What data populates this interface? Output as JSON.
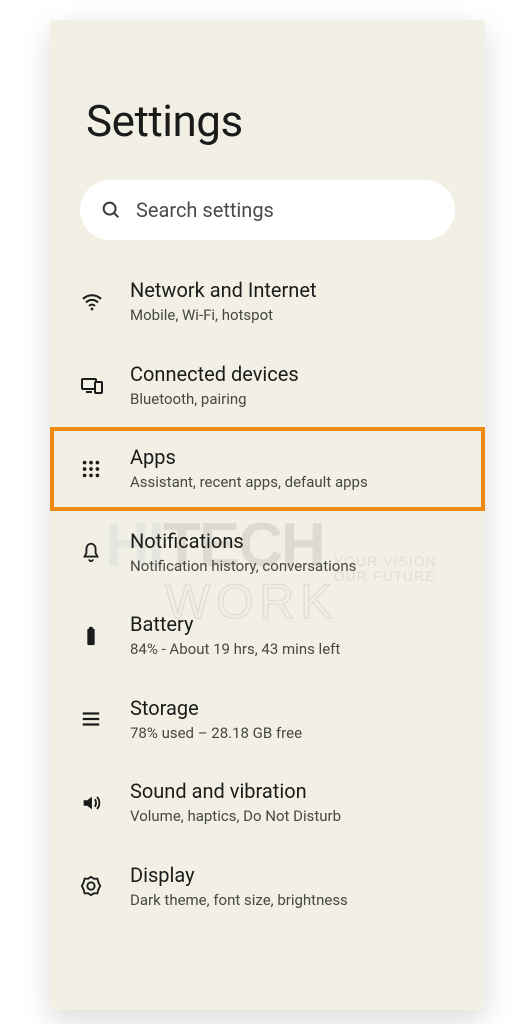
{
  "header": {
    "title": "Settings"
  },
  "search": {
    "placeholder": "Search settings"
  },
  "items": [
    {
      "icon": "wifi-icon",
      "title": "Network and Internet",
      "subtitle": "Mobile, Wi-Fi, hotspot",
      "highlight": false
    },
    {
      "icon": "devices-icon",
      "title": "Connected devices",
      "subtitle": "Bluetooth, pairing",
      "highlight": false
    },
    {
      "icon": "apps-icon",
      "title": "Apps",
      "subtitle": "Assistant, recent apps, default apps",
      "highlight": true
    },
    {
      "icon": "bell-icon",
      "title": "Notifications",
      "subtitle": "Notification history, conversations",
      "highlight": false
    },
    {
      "icon": "battery-icon",
      "title": "Battery",
      "subtitle": "84% - About 19 hrs, 43 mins left",
      "highlight": false
    },
    {
      "icon": "storage-icon",
      "title": "Storage",
      "subtitle": "78% used – 28.18 GB free",
      "highlight": false
    },
    {
      "icon": "sound-icon",
      "title": "Sound and vibration",
      "subtitle": "Volume, haptics, Do Not Disturb",
      "highlight": false
    },
    {
      "icon": "display-icon",
      "title": "Display",
      "subtitle": "Dark theme, font size, brightness",
      "highlight": false
    }
  ],
  "watermark": {
    "line1a": "HI",
    "line1b": "TECH",
    "tag1": "YOUR VISION",
    "tag2": "OUR FUTURE",
    "line2": "WORK"
  },
  "colors": {
    "highlight": "#f08a12",
    "bg": "#f2f0e4"
  }
}
